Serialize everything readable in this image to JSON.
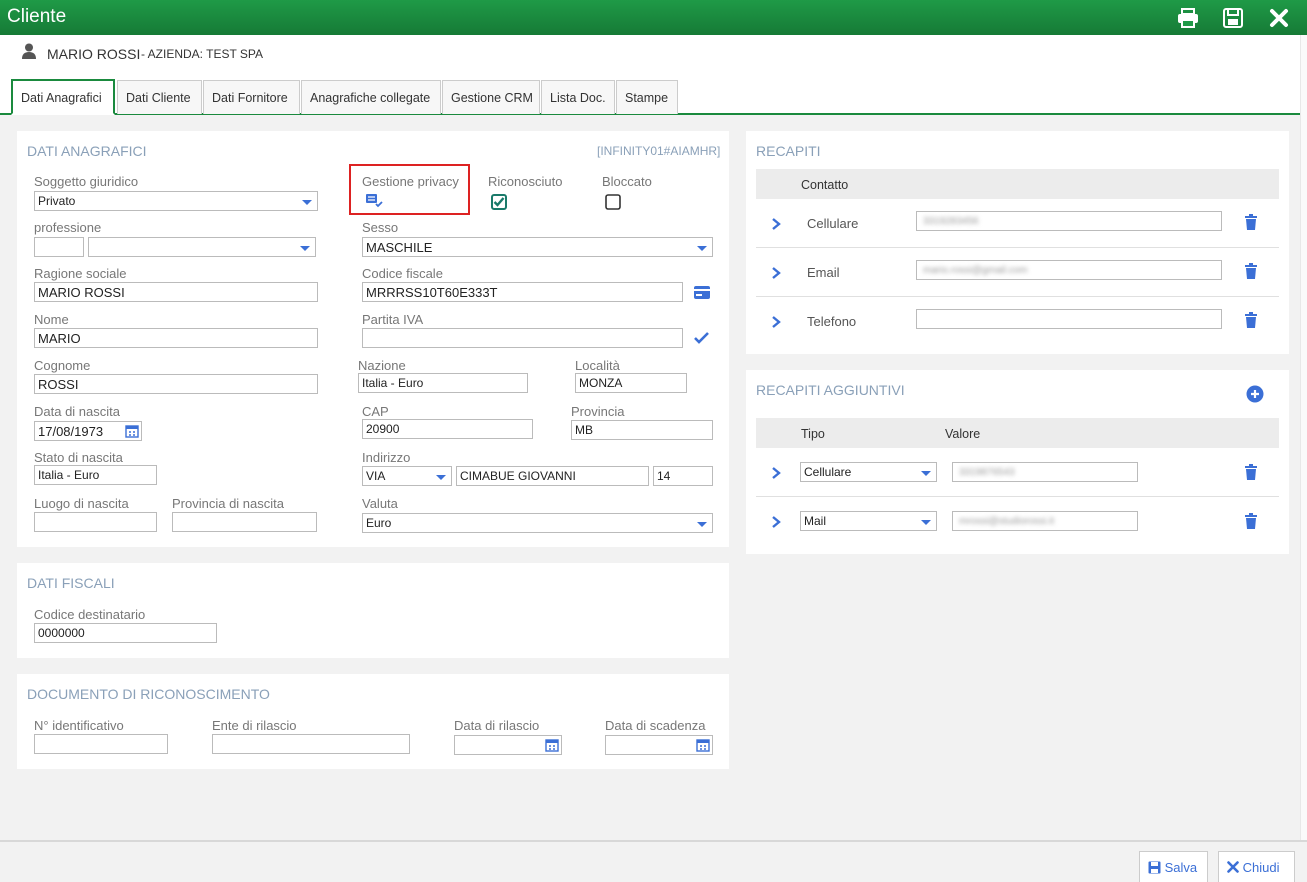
{
  "window": {
    "title": "Cliente",
    "icons": [
      "print-icon",
      "save-icon",
      "close-icon"
    ]
  },
  "user": {
    "name": "MARIO ROSSI",
    "company": "- AZIENDA: TEST SPA"
  },
  "tabs": [
    "Dati Anagrafici",
    "Dati Cliente",
    "Dati Fornitore",
    "Anagrafiche collegate",
    "Gestione CRM",
    "Lista Doc.",
    "Stampe"
  ],
  "anagrafici": {
    "title": "DATI ANAGRAFICI",
    "code": "[INFINITY01#AIAMHR]",
    "soggetto_label": "Soggetto giuridico",
    "soggetto_value": "Privato",
    "privacy_label": "Gestione privacy",
    "riconosciuto_label": "Riconosciuto",
    "riconosciuto_checked": true,
    "bloccato_label": "Bloccato",
    "bloccato_checked": false,
    "professione_label": "professione",
    "sesso_label": "Sesso",
    "sesso_value": "MASCHILE",
    "ragione_label": "Ragione sociale",
    "ragione_value": "MARIO ROSSI",
    "cf_label": "Codice fiscale",
    "cf_value": "MRRRSS10T60E333T",
    "nome_label": "Nome",
    "nome_value": "MARIO",
    "piva_label": "Partita IVA",
    "piva_value": "",
    "cognome_label": "Cognome",
    "cognome_value": "ROSSI",
    "nazione_label": "Nazione",
    "nazione_value": "Italia - Euro",
    "localita_label": "Località",
    "localita_value": "MONZA",
    "nascita_label": "Data di nascita",
    "nascita_value": "17/08/1973",
    "cap_label": "CAP",
    "cap_value": "20900",
    "provincia_label": "Provincia",
    "provincia_value": "MB",
    "stato_label": "Stato di nascita",
    "stato_value": "Italia - Euro",
    "indirizzo_label": "Indirizzo",
    "indirizzo_tipo": "VIA",
    "indirizzo_via": "CIMABUE GIOVANNI",
    "indirizzo_num": "14",
    "luogo_label": "Luogo di nascita",
    "provnascita_label": "Provincia di nascita",
    "valuta_label": "Valuta",
    "valuta_value": "Euro"
  },
  "fiscali": {
    "title": "DATI FISCALI",
    "codice_label": "Codice destinatario",
    "codice_value": "0000000"
  },
  "documento": {
    "title": "DOCUMENTO DI RICONOSCIMENTO",
    "num_label": "N° identificativo",
    "ente_label": "Ente di rilascio",
    "rilascio_label": "Data di rilascio",
    "scadenza_label": "Data di scadenza"
  },
  "recapiti": {
    "title": "RECAPITI",
    "col_contatto": "Contatto",
    "rows": [
      {
        "label": "Cellulare",
        "value": "3319283456"
      },
      {
        "label": "Email",
        "value": "mario.rossi@gmail.com"
      },
      {
        "label": "Telefono",
        "value": ""
      }
    ]
  },
  "aggiuntivi": {
    "title": "RECAPITI AGGIUNTIVI",
    "col_tipo": "Tipo",
    "col_valore": "Valore",
    "rows": [
      {
        "tipo": "Cellulare",
        "valore": "3319876543"
      },
      {
        "tipo": "Mail",
        "valore": "mrossi@studiorossi.it"
      }
    ]
  },
  "footer": {
    "save": "Salva",
    "close": "Chiudi"
  },
  "colors": {
    "header": "#1a8a3e",
    "accent": "#3b6fd6",
    "check": "#1a7a6a",
    "highlight": "#d22222"
  }
}
